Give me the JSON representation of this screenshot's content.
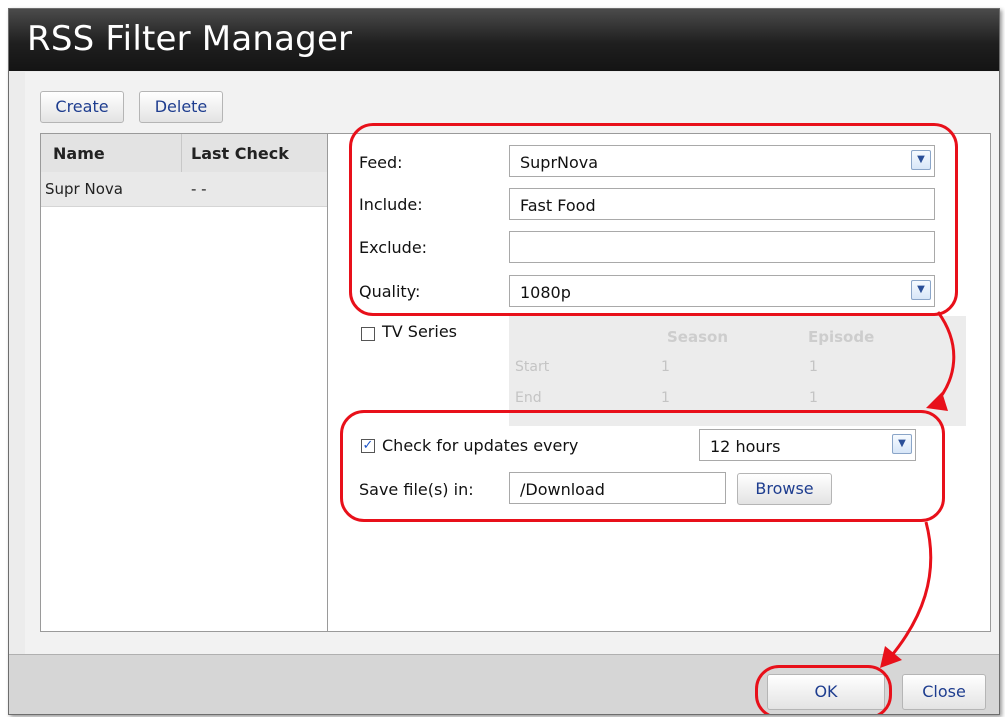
{
  "window": {
    "title": "RSS Filter Manager"
  },
  "toolbar": {
    "create_label": "Create",
    "delete_label": "Delete"
  },
  "filter_list": {
    "columns": [
      "Name",
      "Last Check"
    ],
    "rows": [
      {
        "name": "Supr Nova",
        "last_check": "- -"
      }
    ]
  },
  "form": {
    "feed": {
      "label": "Feed:",
      "value": "SuprNova"
    },
    "include": {
      "label": "Include:",
      "value": "Fast Food"
    },
    "exclude": {
      "label": "Exclude:",
      "value": ""
    },
    "quality": {
      "label": "Quality:",
      "value": "1080p"
    },
    "tv_series": {
      "label": "TV Series",
      "checked": false,
      "columns": [
        "Season",
        "Episode"
      ],
      "rows": [
        {
          "label": "Start",
          "season": "1",
          "episode": "1"
        },
        {
          "label": "End",
          "season": "1",
          "episode": "1"
        }
      ]
    },
    "check_updates": {
      "label": "Check for updates every",
      "checked": true,
      "value": "12 hours"
    },
    "save_files": {
      "label": "Save file(s) in:",
      "value": "/Download",
      "browse_label": "Browse"
    }
  },
  "footer": {
    "ok_label": "OK",
    "close_label": "Close"
  },
  "colors": {
    "annotation": "#e8101a",
    "link_text": "#1e3d8f",
    "title_bar": "#1f1f1f"
  }
}
